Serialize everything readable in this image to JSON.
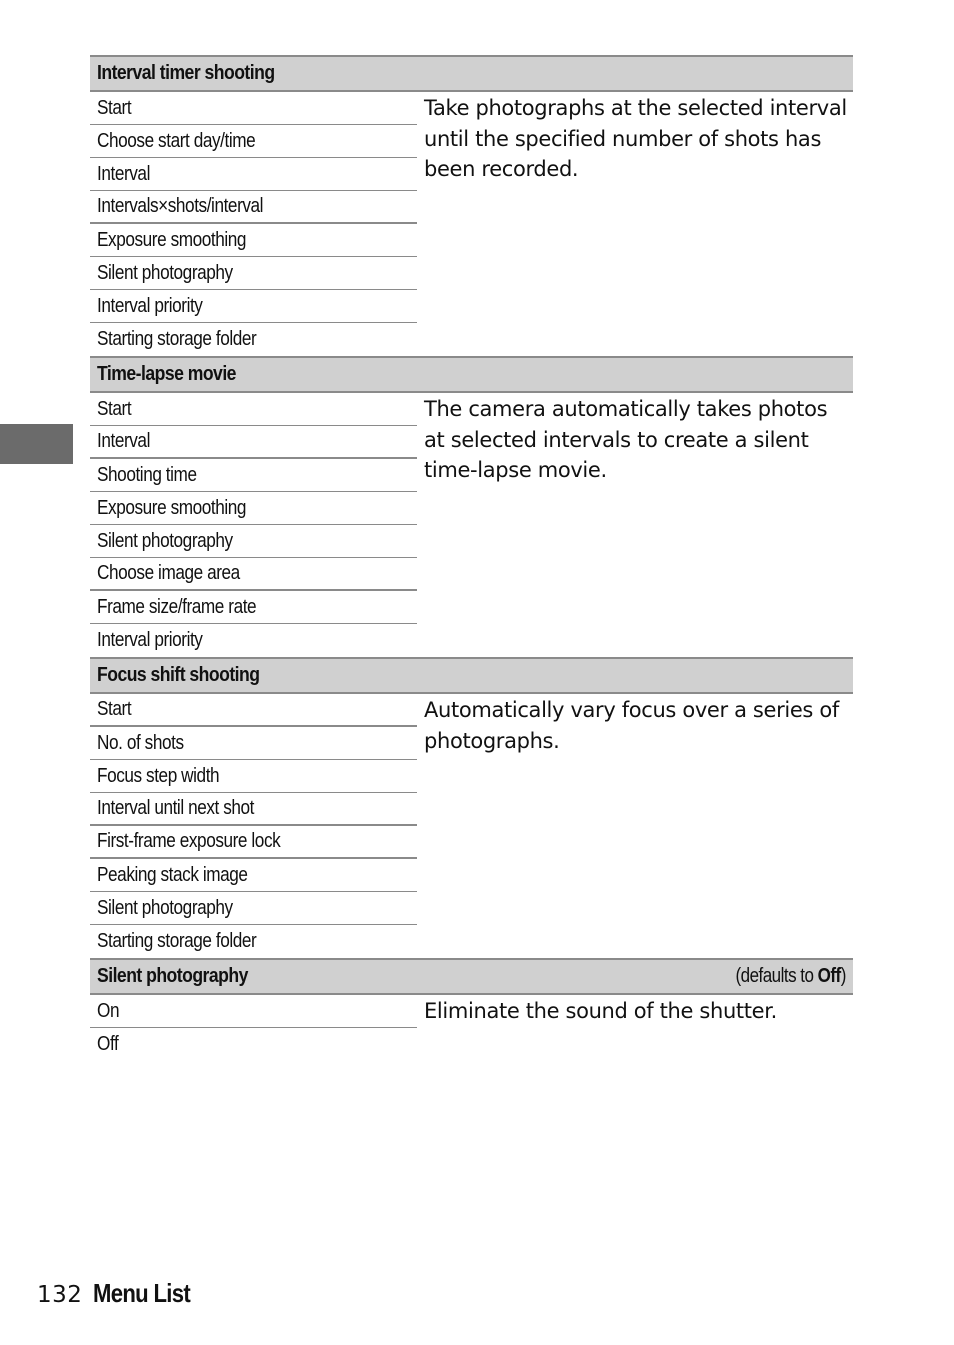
{
  "sections": [
    {
      "title": "Interval timer shooting",
      "default_note": null,
      "description": "Take photographs at the selected interval until the specified number of shots has been recorded.",
      "options": [
        "Start",
        "Choose start day/time",
        "Interval",
        "Intervals×shots/interval",
        "Exposure smoothing",
        "Silent photography",
        "Interval priority",
        "Starting storage folder"
      ]
    },
    {
      "title": "Time-lapse movie",
      "default_note": null,
      "description": "The camera automatically takes photos at selected intervals to create a silent time-lapse movie.",
      "options": [
        "Start",
        "Interval",
        "Shooting time",
        "Exposure smoothing",
        "Silent photography",
        "Choose image area",
        "Frame size/frame rate",
        "Interval priority"
      ]
    },
    {
      "title": "Focus shift shooting",
      "default_note": null,
      "description": "Automatically vary focus over a series of photographs.",
      "options": [
        "Start",
        "No. of shots",
        "Focus step width",
        "Interval until next shot",
        "First-frame exposure lock",
        "Peaking stack image",
        "Silent photography",
        "Starting storage folder"
      ]
    },
    {
      "title": "Silent photography",
      "default_note": {
        "prefix": "(defaults to ",
        "value": "Off",
        "suffix": ")"
      },
      "description": "Eliminate the sound of the shutter.",
      "options": [
        "On",
        "Off"
      ]
    }
  ],
  "footer": {
    "page_number": "132",
    "section_title": "Menu List"
  },
  "colors": {
    "header_band": "#d0d0d0",
    "rule": "#8a8a8a",
    "side_tab": "#6b6b6b"
  }
}
